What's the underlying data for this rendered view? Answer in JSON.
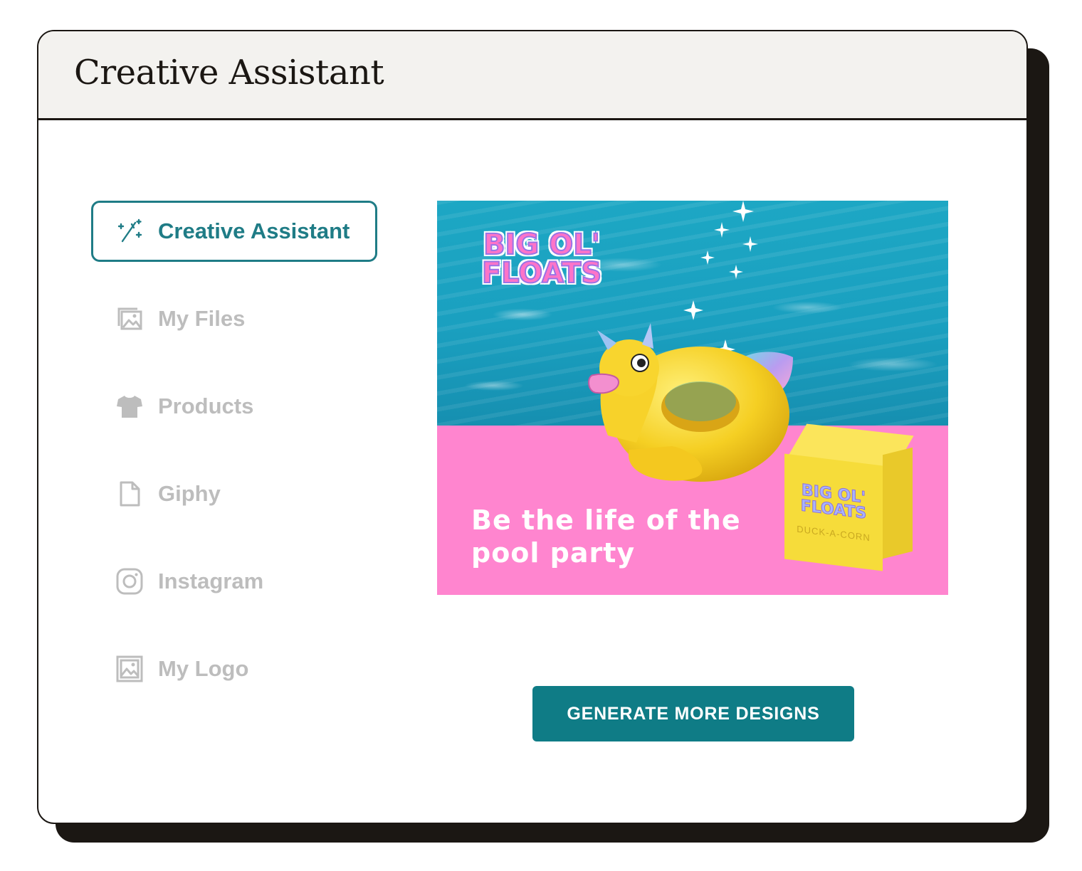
{
  "window": {
    "title": "Creative Assistant"
  },
  "sidebar": {
    "items": [
      {
        "label": "Creative Assistant",
        "icon": "magic-wand-icon",
        "active": true
      },
      {
        "label": "My Files",
        "icon": "images-icon",
        "active": false
      },
      {
        "label": "Products",
        "icon": "tshirt-icon",
        "active": false
      },
      {
        "label": "Giphy",
        "icon": "document-icon",
        "active": false
      },
      {
        "label": "Instagram",
        "icon": "instagram-icon",
        "active": false
      },
      {
        "label": "My Logo",
        "icon": "image-icon",
        "active": false
      }
    ]
  },
  "design": {
    "logo_text": "BIG OL' FLOATS",
    "tagline": "Be the life of the pool party",
    "box_logo": "BIG OL' FLOATS",
    "box_product": "DUCK-A-CORN"
  },
  "actions": {
    "generate_label": "GENERATE MORE DESIGNS"
  },
  "colors": {
    "accent": "#0f7c86",
    "inactive": "#bdbdbd",
    "pink": "#ff85cf",
    "water": "#1da7c4"
  }
}
